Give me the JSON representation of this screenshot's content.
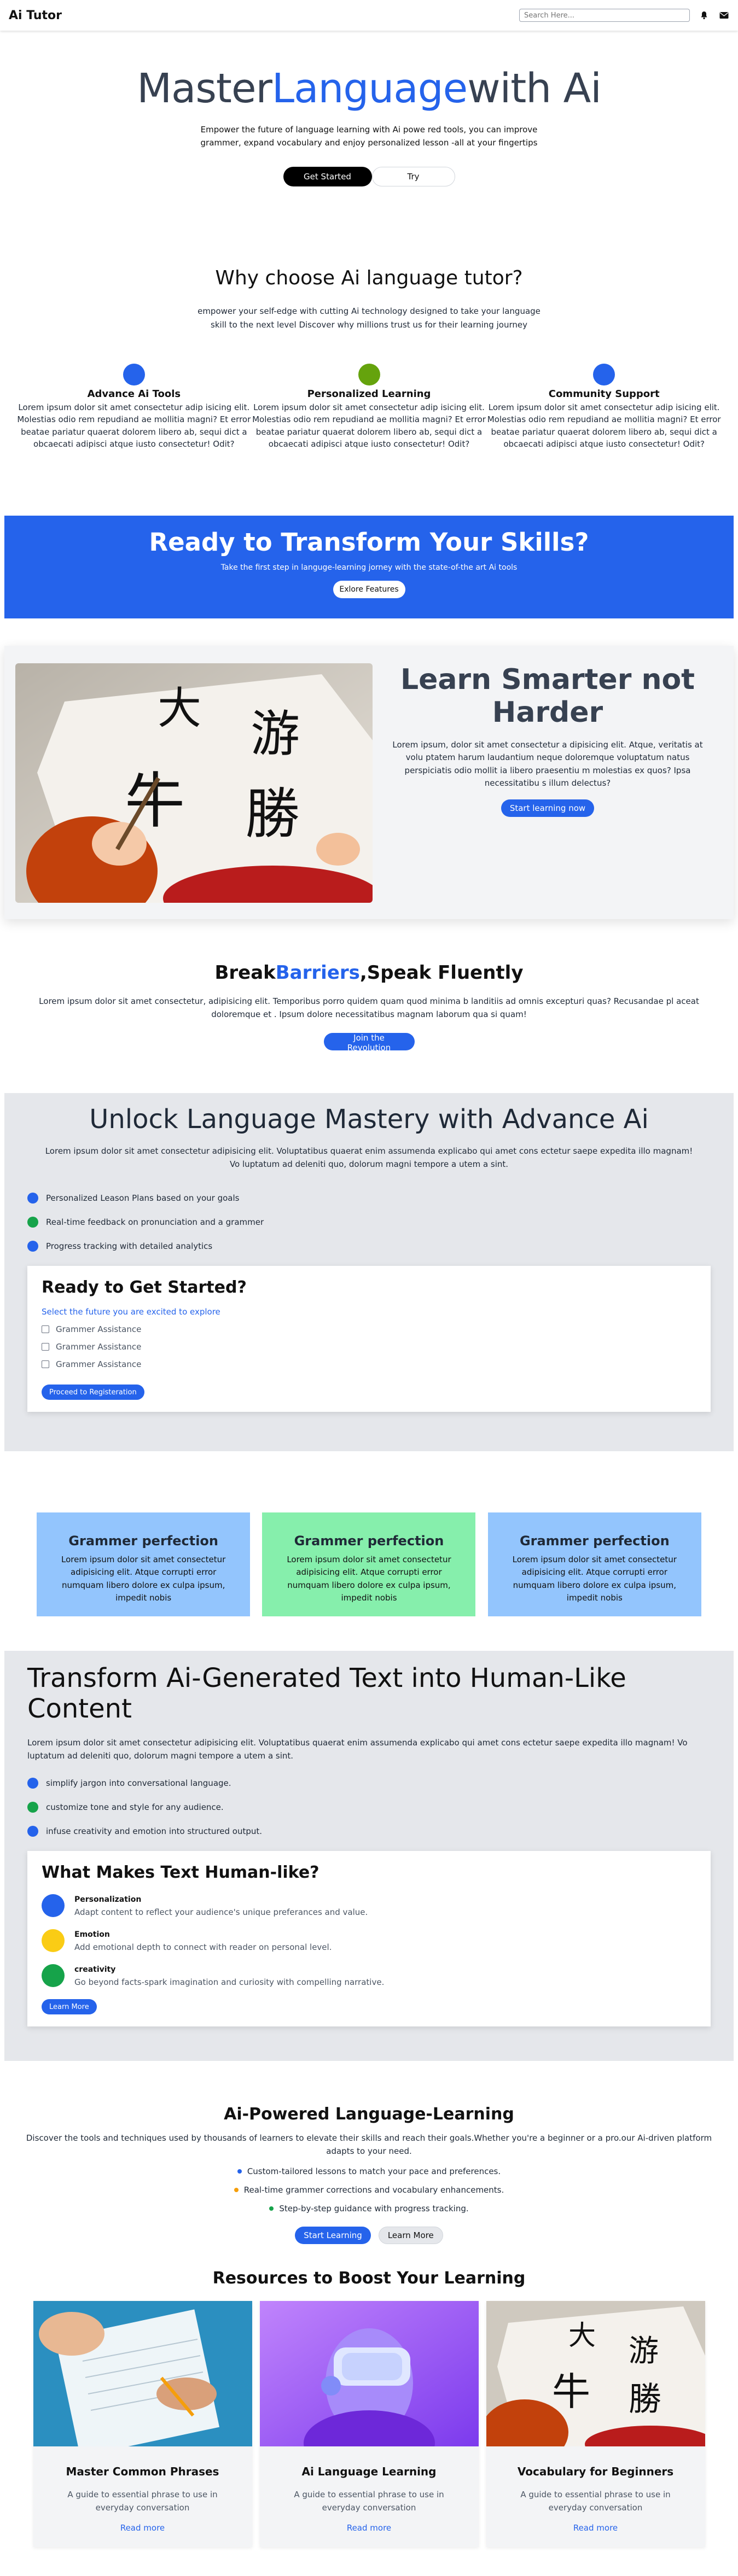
{
  "nav": {
    "logo": "Ai Tutor",
    "search_placeholder": "Search Here..."
  },
  "hero": {
    "title_a": "Master",
    "title_b": "Language",
    "title_c": "with Ai",
    "text": "Empower the future of language learning with Ai powe red tools, you can improve grammer, expand vocabulary and enjoy personalized lesson -all at your fingertips",
    "primary": "Get Started",
    "secondary": "Try"
  },
  "why": {
    "title": "Why choose Ai language tutor?",
    "text": "empower your self-edge with cutting Ai technology designed to take your language skill to the next level Discover why millions trust us for their learning journey",
    "features": [
      {
        "title": "Advance Ai Tools",
        "text": "Lorem ipsum dolor sit amet consectetur adip isicing elit. Molestias odio rem repudiand ae mollitia magni? Et error beatae pariatur quaerat dolorem libero ab, sequi dict a obcaecati adipisci atque iusto consectetur! Odit?",
        "color": "#2563eb"
      },
      {
        "title": "Personalized Learning",
        "text": "Lorem ipsum dolor sit amet consectetur adip isicing elit. Molestias odio rem repudiand ae mollitia magni? Et error beatae pariatur quaerat dolorem libero ab, sequi dict a obcaecati adipisci atque iusto consectetur! Odit?",
        "color": "#65a30d"
      },
      {
        "title": "Community Support",
        "text": "Lorem ipsum dolor sit amet consectetur adip isicing elit. Molestias odio rem repudiand ae mollitia magni? Et error beatae pariatur quaerat dolorem libero ab, sequi dict a obcaecati adipisci atque iusto consectetur! Odit?",
        "color": "#2563eb"
      }
    ]
  },
  "cta": {
    "title": "Ready to Transform Your Skills?",
    "text": "Take the first step in languge-learning jorney with the state-of-the art Ai tools",
    "button": "Exlore Features"
  },
  "smarter": {
    "title": "Learn Smarter not Harder",
    "text": "Lorem ipsum, dolor sit amet consectetur a dipisicing elit. Atque, veritatis at volu ptatem harum laudantium neque doloremque voluptatum natus perspiciatis odio mollit ia libero praesentiu m molestias ex quos? Ipsa necessitatibu s illum delectus?",
    "button": "Start learning now"
  },
  "breaks": {
    "title_a": "Break",
    "title_b": "Barriers",
    "title_c": ",Speak Fluently",
    "text": "Lorem ipsum dolor sit amet consectetur, adipisicing elit. Temporibus porro quidem quam quod minima b landitiis ad omnis excepturi quas? Recusandae pl aceat doloremque et . Ipsum dolore necessitatibus magnam laborum qua si quam!",
    "button": "Join the Revolution"
  },
  "unlock": {
    "title": "Unlock Language Mastery with Advance Ai",
    "text": "Lorem ipsum dolor sit amet consectetur adipisicing elit. Voluptatibus quaerat enim assumenda explicabo qui amet cons ectetur saepe expedita illo magnam! Vo luptatum ad deleniti quo, dolorum magni tempore a utem a sint.",
    "bullets": [
      {
        "text": "Personalized Leason Plans based on your goals",
        "color": "#2563eb"
      },
      {
        "text": "Real-time feedback on pronunciation and a grammer",
        "color": "#16a34a"
      },
      {
        "text": "Progress tracking with detailed analytics",
        "color": "#2563eb"
      }
    ],
    "card": {
      "title": "Ready to Get Started?",
      "subtitle": "Select the future you are excited to explore",
      "options": [
        "Grammer Assistance",
        "Grammer Assistance",
        "Grammer Assistance"
      ],
      "button": "Proceed to Registeration"
    }
  },
  "grammar": [
    {
      "title": "Grammer perfection",
      "text": "Lorem ipsum dolor sit amet consectetur adipisicing elit. Atque corrupti error numquam libero dolore ex culpa ipsum, impedit nobis",
      "color": "#93c5fd"
    },
    {
      "title": "Grammer perfection",
      "text": "Lorem ipsum dolor sit amet consectetur adipisicing elit. Atque corrupti error numquam libero dolore ex culpa ipsum, impedit nobis",
      "color": "#86efac"
    },
    {
      "title": "Grammer perfection",
      "text": "Lorem ipsum dolor sit amet consectetur adipisicing elit. Atque corrupti error numquam libero dolore ex culpa ipsum, impedit nobis",
      "color": "#93c5fd"
    }
  ],
  "transform": {
    "title": "Transform Ai-Generated Text into Human-Like Content",
    "text": "Lorem ipsum dolor sit amet consectetur adipisicing elit. Voluptatibus quaerat enim assumenda explicabo qui amet cons ectetur saepe expedita illo magnam! Vo luptatum ad deleniti quo, dolorum magni tempore a utem a sint.",
    "bullets": [
      {
        "text": "simplify jargon into conversational language.",
        "color": "#2563eb"
      },
      {
        "text": "customize tone and style for any audience.",
        "color": "#16a34a"
      },
      {
        "text": "infuse creativity and emotion into structured output.",
        "color": "#2563eb"
      }
    ],
    "card": {
      "title": "What Makes Text Human-like?",
      "items": [
        {
          "title": "Personalization",
          "text": "Adapt content to reflect your audience's unique preferances and value.",
          "color": "#2563eb"
        },
        {
          "title": "Emotion",
          "text": "Add emotional depth to connect with reader on personal level.",
          "color": "#facc15"
        },
        {
          "title": "creativity",
          "text": "Go beyond facts-spark imagination and curiosity with compelling narrative.",
          "color": "#16a34a"
        }
      ],
      "button": "Learn More"
    }
  },
  "aip": {
    "title": "Ai-Powered Language-Learning",
    "text": "Discover the tools and techniques used by thousands of learners to elevate their skills and reach their goals.Whether you're a beginner or a pro.our Ai-driven platform adapts to your need.",
    "items": [
      {
        "text": "Custom-tailored lessons to match your pace and preferences.",
        "color": "#2563eb"
      },
      {
        "text": "Real-time grammer corrections and vocabulary enhancements.",
        "color": "#f59e0b"
      },
      {
        "text": "Step-by-step guidance with progress tracking.",
        "color": "#16a34a"
      }
    ],
    "primary": "Start Learning",
    "secondary": "Learn More"
  },
  "resources": {
    "title": "Resources to Boost Your Learning",
    "cards": [
      {
        "title": "Master Common Phrases",
        "text": "A guide to essential phrase to use in everyday conversation",
        "link": "Read more"
      },
      {
        "title": "Ai Language Learning",
        "text": "A guide to essential phrase to use in everyday conversation",
        "link": "Read more"
      },
      {
        "title": "Vocabulary for Beginners",
        "text": "A guide to essential phrase to use in everyday conversation",
        "link": "Read more"
      }
    ]
  }
}
